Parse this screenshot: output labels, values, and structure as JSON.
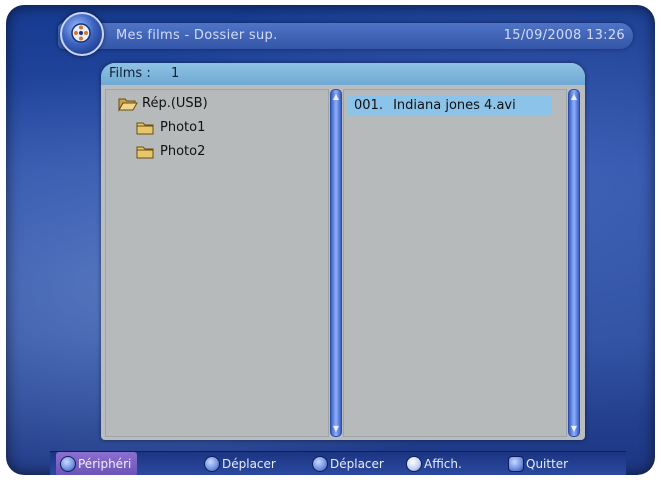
{
  "header": {
    "title": "Mes films - Dossier sup.",
    "datetime": "15/09/2008 13:26"
  },
  "panel": {
    "label": "Films :",
    "count": "1"
  },
  "tree": {
    "items": [
      {
        "label": "Rép.(USB)",
        "icon": "folder-open-icon"
      },
      {
        "label": "Photo1",
        "icon": "folder-icon"
      },
      {
        "label": "Photo2",
        "icon": "folder-icon"
      }
    ]
  },
  "files": {
    "items": [
      {
        "number": "001.",
        "name": "Indiana jones 4.avi"
      }
    ]
  },
  "footer": {
    "peripheral": "Périphéri",
    "move_vertical": "Déplacer",
    "move_horizontal": "Déplacer",
    "display": "Affich.",
    "quit": "Quitter"
  },
  "colors": {
    "background": "#2a4fa8",
    "panel": "#b9bdbf",
    "panel_header": "#8fc3e4",
    "selection": "#8bc3e9",
    "footer_highlight": "#7b60c4"
  }
}
